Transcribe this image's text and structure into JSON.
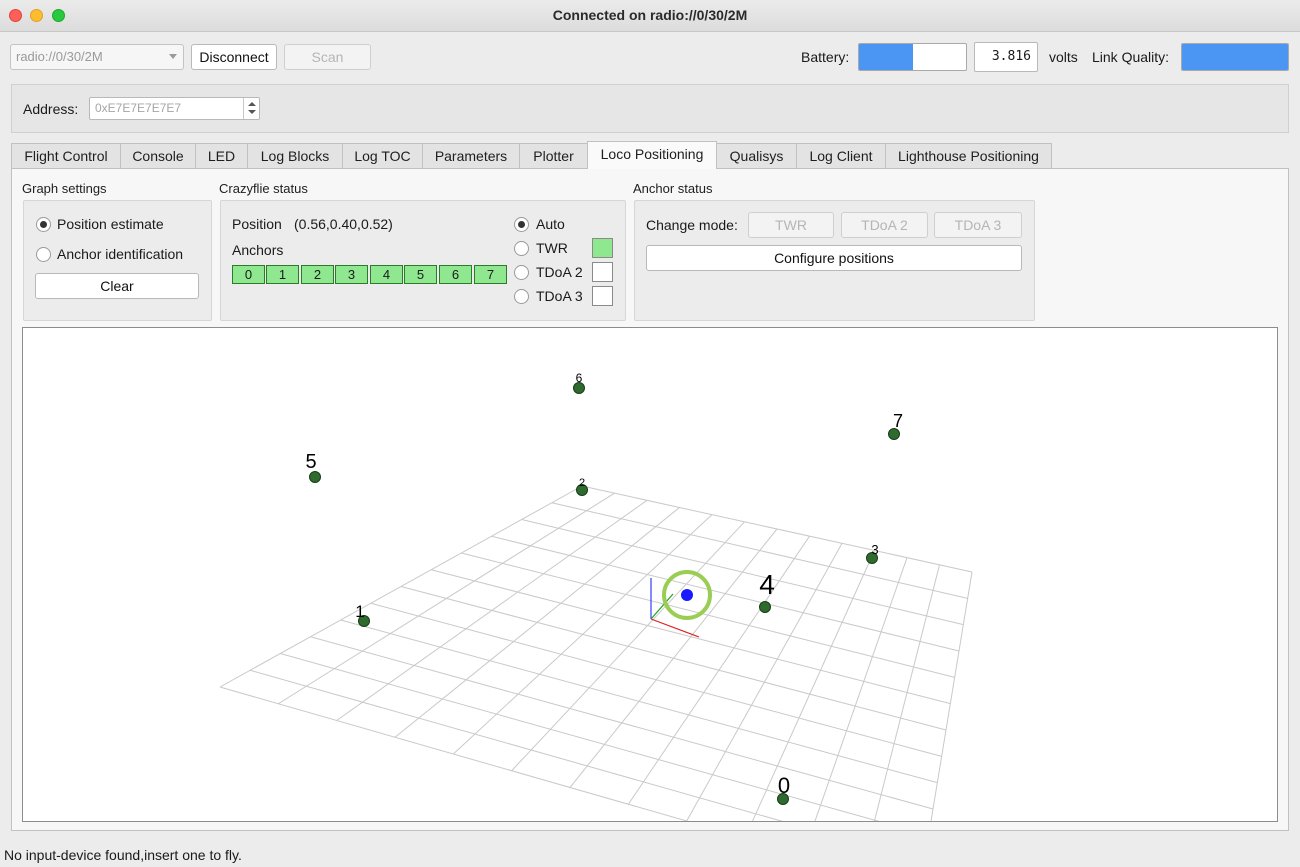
{
  "window": {
    "title": "Connected on radio://0/30/2M"
  },
  "toolbar": {
    "uri_value": "radio://0/30/2M",
    "disconnect_label": "Disconnect",
    "scan_label": "Scan",
    "battery_label": "Battery:",
    "battery_level": 0.5,
    "battery_voltage": "3.816",
    "volts_label": "volts",
    "link_quality_label": "Link Quality:",
    "link_quality_level": 1.0,
    "bar_color": "#4b95f3"
  },
  "address": {
    "label": "Address:",
    "value": "0xE7E7E7E7E7"
  },
  "tabs": [
    {
      "label": "Flight Control",
      "active": false
    },
    {
      "label": "Console",
      "active": false
    },
    {
      "label": "LED",
      "active": false
    },
    {
      "label": "Log Blocks",
      "active": false
    },
    {
      "label": "Log TOC",
      "active": false
    },
    {
      "label": "Parameters",
      "active": false
    },
    {
      "label": "Plotter",
      "active": false
    },
    {
      "label": "Loco Positioning",
      "active": true
    },
    {
      "label": "Qualisys",
      "active": false
    },
    {
      "label": "Log Client",
      "active": false
    },
    {
      "label": "Lighthouse Positioning",
      "active": false
    }
  ],
  "graph_settings": {
    "title": "Graph settings",
    "options": [
      "Position estimate",
      "Anchor identification"
    ],
    "selected": "Position estimate",
    "clear_label": "Clear"
  },
  "crazyflie_status": {
    "title": "Crazyflie status",
    "position_label": "Position",
    "position_value": "(0.56,0.40,0.52)",
    "anchors_label": "Anchors",
    "anchors": [
      "0",
      "1",
      "2",
      "3",
      "4",
      "5",
      "6",
      "7"
    ],
    "anchor_ok_color": "#8fe88f",
    "modes": [
      "Auto",
      "TWR",
      "TDoA 2",
      "TDoA 3"
    ],
    "selected_mode": "Auto",
    "active_indicator": "TWR"
  },
  "anchor_status": {
    "title": "Anchor status",
    "change_mode_label": "Change mode:",
    "mode_buttons": [
      "TWR",
      "TDoA 2",
      "TDoA 3"
    ],
    "configure_label": "Configure positions"
  },
  "scene": {
    "anchor_labels": [
      "0",
      "1",
      "2",
      "3",
      "4",
      "5",
      "6",
      "7"
    ],
    "anchor_color": "#2f6b2f",
    "crazyflie_color": "#1a1aff",
    "highlight_ring_color": "#9acd54"
  },
  "statusbar": {
    "message": "No input-device found,insert one to fly."
  }
}
